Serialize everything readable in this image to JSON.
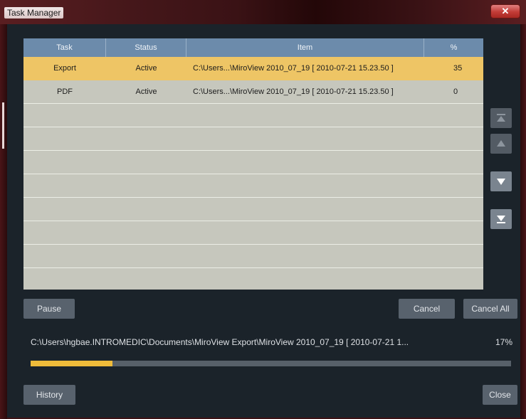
{
  "window": {
    "title": "Task Manager",
    "close_glyph": "✕"
  },
  "grid": {
    "columns": [
      "Task",
      "Status",
      "Item",
      "%"
    ],
    "rows": [
      {
        "task": "Export",
        "status": "Active",
        "item": "C:\\Users...\\MiroView 2010_07_19 [ 2010-07-21 15.23.50 ]",
        "percent": "35"
      },
      {
        "task": "PDF",
        "status": "Active",
        "item": "C:\\Users...\\MiroView 2010_07_19 [ 2010-07-21 15.23.50 ]",
        "percent": "0"
      }
    ]
  },
  "arrows": [
    {
      "name": "move-to-top-icon",
      "state": "disabled"
    },
    {
      "name": "move-up-icon",
      "state": "disabled"
    },
    {
      "name": "move-down-icon",
      "state": "enabled"
    },
    {
      "name": "move-to-bottom-icon",
      "state": "enabled"
    }
  ],
  "buttons": {
    "pause": "Pause",
    "cancel": "Cancel",
    "cancel_all": "Cancel All",
    "history": "History",
    "close": "Close"
  },
  "current_task": {
    "path": "C:\\Users\\hgbae.INTROMEDIC\\Documents\\MiroView Export\\MiroView 2010_07_19 [ 2010-07-21 1...",
    "percent_label": "17%",
    "progress": 0.17
  },
  "colors": {
    "accent": "#efbb3a",
    "selected_row": "#eec565",
    "header": "#6c8bab",
    "background": "#1b232a"
  }
}
